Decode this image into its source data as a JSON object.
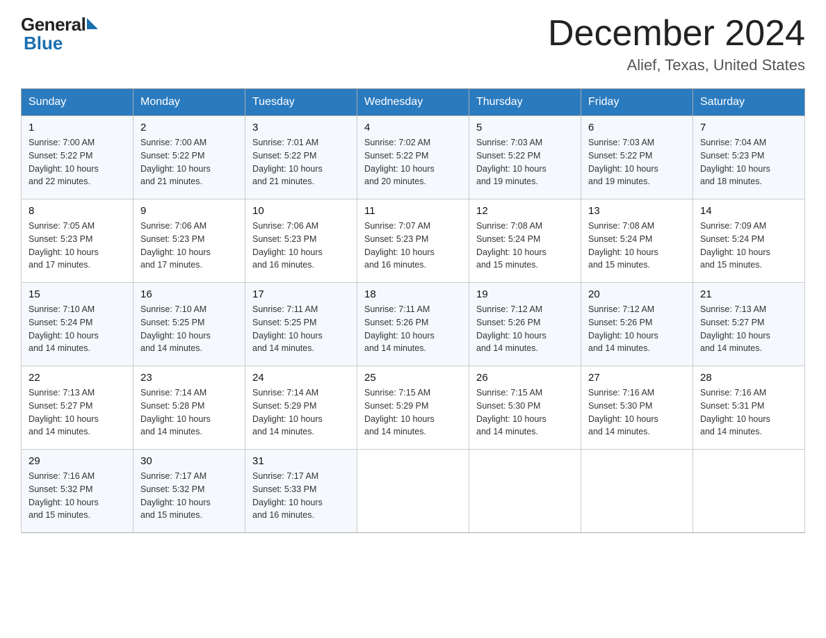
{
  "header": {
    "logo_general": "General",
    "logo_blue": "Blue",
    "month_year": "December 2024",
    "location": "Alief, Texas, United States"
  },
  "days_of_week": [
    "Sunday",
    "Monday",
    "Tuesday",
    "Wednesday",
    "Thursday",
    "Friday",
    "Saturday"
  ],
  "weeks": [
    [
      {
        "day": "1",
        "sunrise": "7:00 AM",
        "sunset": "5:22 PM",
        "daylight": "10 hours and 22 minutes."
      },
      {
        "day": "2",
        "sunrise": "7:00 AM",
        "sunset": "5:22 PM",
        "daylight": "10 hours and 21 minutes."
      },
      {
        "day": "3",
        "sunrise": "7:01 AM",
        "sunset": "5:22 PM",
        "daylight": "10 hours and 21 minutes."
      },
      {
        "day": "4",
        "sunrise": "7:02 AM",
        "sunset": "5:22 PM",
        "daylight": "10 hours and 20 minutes."
      },
      {
        "day": "5",
        "sunrise": "7:03 AM",
        "sunset": "5:22 PM",
        "daylight": "10 hours and 19 minutes."
      },
      {
        "day": "6",
        "sunrise": "7:03 AM",
        "sunset": "5:22 PM",
        "daylight": "10 hours and 19 minutes."
      },
      {
        "day": "7",
        "sunrise": "7:04 AM",
        "sunset": "5:23 PM",
        "daylight": "10 hours and 18 minutes."
      }
    ],
    [
      {
        "day": "8",
        "sunrise": "7:05 AM",
        "sunset": "5:23 PM",
        "daylight": "10 hours and 17 minutes."
      },
      {
        "day": "9",
        "sunrise": "7:06 AM",
        "sunset": "5:23 PM",
        "daylight": "10 hours and 17 minutes."
      },
      {
        "day": "10",
        "sunrise": "7:06 AM",
        "sunset": "5:23 PM",
        "daylight": "10 hours and 16 minutes."
      },
      {
        "day": "11",
        "sunrise": "7:07 AM",
        "sunset": "5:23 PM",
        "daylight": "10 hours and 16 minutes."
      },
      {
        "day": "12",
        "sunrise": "7:08 AM",
        "sunset": "5:24 PM",
        "daylight": "10 hours and 15 minutes."
      },
      {
        "day": "13",
        "sunrise": "7:08 AM",
        "sunset": "5:24 PM",
        "daylight": "10 hours and 15 minutes."
      },
      {
        "day": "14",
        "sunrise": "7:09 AM",
        "sunset": "5:24 PM",
        "daylight": "10 hours and 15 minutes."
      }
    ],
    [
      {
        "day": "15",
        "sunrise": "7:10 AM",
        "sunset": "5:24 PM",
        "daylight": "10 hours and 14 minutes."
      },
      {
        "day": "16",
        "sunrise": "7:10 AM",
        "sunset": "5:25 PM",
        "daylight": "10 hours and 14 minutes."
      },
      {
        "day": "17",
        "sunrise": "7:11 AM",
        "sunset": "5:25 PM",
        "daylight": "10 hours and 14 minutes."
      },
      {
        "day": "18",
        "sunrise": "7:11 AM",
        "sunset": "5:26 PM",
        "daylight": "10 hours and 14 minutes."
      },
      {
        "day": "19",
        "sunrise": "7:12 AM",
        "sunset": "5:26 PM",
        "daylight": "10 hours and 14 minutes."
      },
      {
        "day": "20",
        "sunrise": "7:12 AM",
        "sunset": "5:26 PM",
        "daylight": "10 hours and 14 minutes."
      },
      {
        "day": "21",
        "sunrise": "7:13 AM",
        "sunset": "5:27 PM",
        "daylight": "10 hours and 14 minutes."
      }
    ],
    [
      {
        "day": "22",
        "sunrise": "7:13 AM",
        "sunset": "5:27 PM",
        "daylight": "10 hours and 14 minutes."
      },
      {
        "day": "23",
        "sunrise": "7:14 AM",
        "sunset": "5:28 PM",
        "daylight": "10 hours and 14 minutes."
      },
      {
        "day": "24",
        "sunrise": "7:14 AM",
        "sunset": "5:29 PM",
        "daylight": "10 hours and 14 minutes."
      },
      {
        "day": "25",
        "sunrise": "7:15 AM",
        "sunset": "5:29 PM",
        "daylight": "10 hours and 14 minutes."
      },
      {
        "day": "26",
        "sunrise": "7:15 AM",
        "sunset": "5:30 PM",
        "daylight": "10 hours and 14 minutes."
      },
      {
        "day": "27",
        "sunrise": "7:16 AM",
        "sunset": "5:30 PM",
        "daylight": "10 hours and 14 minutes."
      },
      {
        "day": "28",
        "sunrise": "7:16 AM",
        "sunset": "5:31 PM",
        "daylight": "10 hours and 14 minutes."
      }
    ],
    [
      {
        "day": "29",
        "sunrise": "7:16 AM",
        "sunset": "5:32 PM",
        "daylight": "10 hours and 15 minutes."
      },
      {
        "day": "30",
        "sunrise": "7:17 AM",
        "sunset": "5:32 PM",
        "daylight": "10 hours and 15 minutes."
      },
      {
        "day": "31",
        "sunrise": "7:17 AM",
        "sunset": "5:33 PM",
        "daylight": "10 hours and 16 minutes."
      },
      null,
      null,
      null,
      null
    ]
  ],
  "labels": {
    "sunrise": "Sunrise:",
    "sunset": "Sunset:",
    "daylight": "Daylight:"
  }
}
